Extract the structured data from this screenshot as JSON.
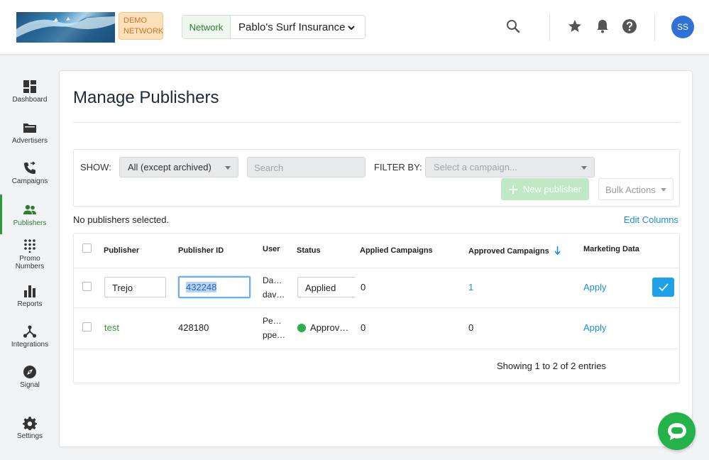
{
  "header": {
    "demo_badge_line1": "DEMO",
    "demo_badge_line2": "NETWORK",
    "network_label": "Network",
    "network_value": "Pablo's Surf Insurance",
    "avatar_initials": "SS"
  },
  "sidebar": {
    "items": [
      {
        "label": "Dashboard",
        "icon": "dashboard-icon"
      },
      {
        "label": "Advertisers",
        "icon": "folder-icon"
      },
      {
        "label": "Campaigns",
        "icon": "call-forward-icon"
      },
      {
        "label": "Publishers",
        "icon": "people-icon",
        "active": true
      },
      {
        "label_line1": "Promo",
        "label_line2": "Numbers",
        "icon": "dialpad-icon"
      },
      {
        "label": "Reports",
        "icon": "bar-chart-icon"
      },
      {
        "label": "Integrations",
        "icon": "network-icon"
      },
      {
        "label": "Signal",
        "icon": "compass-icon"
      },
      {
        "label": "Settings",
        "icon": "gear-icon"
      }
    ]
  },
  "main": {
    "title": "Manage Publishers",
    "filters": {
      "show_label": "SHOW:",
      "show_value": "All (except archived)",
      "search_placeholder": "Search",
      "filter_label": "FILTER BY:",
      "campaign_placeholder": "Select a campaign...",
      "new_publisher_label": "New publisher",
      "bulk_actions_label": "Bulk Actions"
    },
    "selection_info": "No publishers selected.",
    "edit_columns_label": "Edit Columns",
    "table": {
      "columns": [
        "Publisher",
        "Publisher ID",
        "User",
        "Status",
        "Applied Campaigns",
        "Approved Campaigns",
        "Marketing Data"
      ],
      "rows": [
        {
          "publisher": "Trejo",
          "publisher_id": "432248",
          "user_line1": "Da…",
          "user_line2": "dav…",
          "status": "Applied",
          "applied": "0",
          "approved": "1",
          "marketing": "Apply"
        },
        {
          "publisher": "test",
          "publisher_id": "428180",
          "user_line1": "Pe…",
          "user_line2": "ppe…",
          "status": "Approv…",
          "applied": "0",
          "approved": "0",
          "marketing": "Apply"
        }
      ],
      "footer": "Showing 1 to 2 of 2 entries"
    }
  },
  "colors": {
    "accent_green": "#2f9a3a",
    "link_blue": "#1a8fd6",
    "avatar_blue": "#2f72d7",
    "badge_orange": "#fbe1b9"
  }
}
